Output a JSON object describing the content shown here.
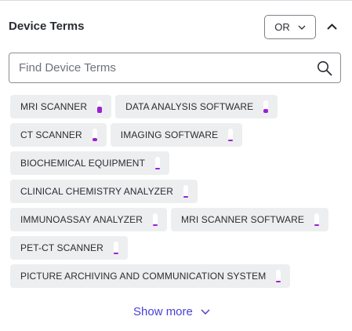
{
  "header": {
    "title": "Device Terms",
    "logic_value": "OR"
  },
  "search": {
    "placeholder": "Find Device Terms",
    "value": ""
  },
  "chips": [
    [
      {
        "label": "MRI SCANNER",
        "level": 0.5
      },
      {
        "label": "DATA ANALYSIS SOFTWARE",
        "level": 0.3
      }
    ],
    [
      {
        "label": "CT SCANNER",
        "level": 0.25
      },
      {
        "label": "IMAGING SOFTWARE",
        "level": 0.1
      }
    ],
    [
      {
        "label": "BIOCHEMICAL EQUIPMENT",
        "level": 0.08
      }
    ],
    [
      {
        "label": "CLINICAL CHEMISTRY ANALYZER",
        "level": 0.06
      }
    ],
    [
      {
        "label": "IMMUNOASSAY ANALYZER",
        "level": 0.06
      },
      {
        "label": "MRI SCANNER SOFTWARE",
        "level": 0.06
      }
    ],
    [
      {
        "label": "PET-CT SCANNER",
        "level": 0.06
      }
    ],
    [
      {
        "label": "PICTURE ARCHIVING AND COMMUNICATION SYSTEM",
        "level": 0.06
      }
    ]
  ],
  "footer": {
    "show_more_label": "Show more"
  },
  "colors": {
    "bar_fill": "#9b1fd4",
    "link": "#4b3fd6",
    "chip_bg": "#edeeef"
  }
}
